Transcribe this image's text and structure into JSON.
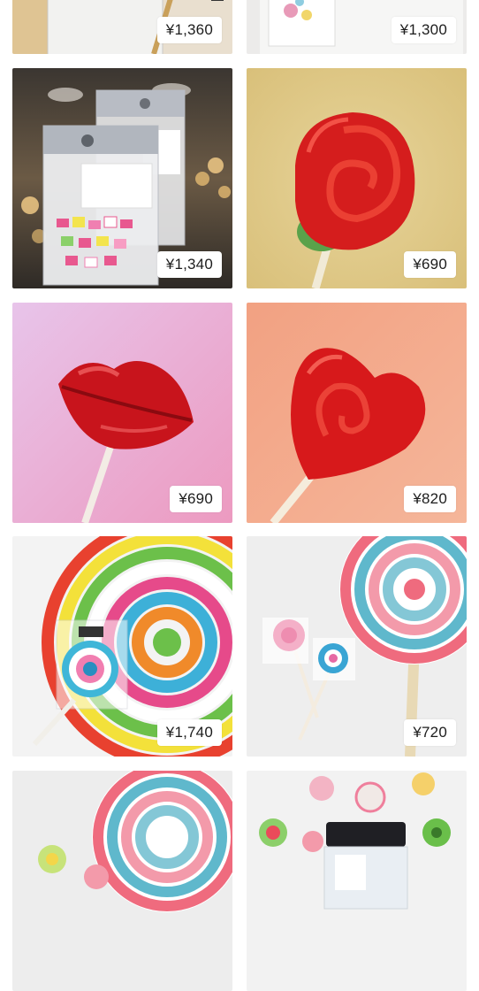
{
  "products": [
    {
      "price": "¥1,360",
      "image": "candy-bag-gold-image"
    },
    {
      "price": "¥1,300",
      "image": "candy-art-card-image"
    },
    {
      "price": "¥1,340",
      "image": "candy-packs-bokeh-image"
    },
    {
      "price": "¥690",
      "image": "rose-lollipop-image"
    },
    {
      "price": "¥690",
      "image": "lips-lollipop-image"
    },
    {
      "price": "¥820",
      "image": "heart-lollipop-image"
    },
    {
      "price": "¥1,740",
      "image": "rainbow-swirl-lollipop-image"
    },
    {
      "price": "¥720",
      "image": "pastel-swirl-lollipop-image"
    },
    {
      "price": "",
      "image": "pastel-swirl-lollipop-2-image"
    },
    {
      "price": "",
      "image": "candy-jar-image"
    }
  ],
  "colors": {
    "price_badge_bg": "#ffffff",
    "price_text": "#1c1c1c",
    "page_bg": "#ffffff"
  }
}
